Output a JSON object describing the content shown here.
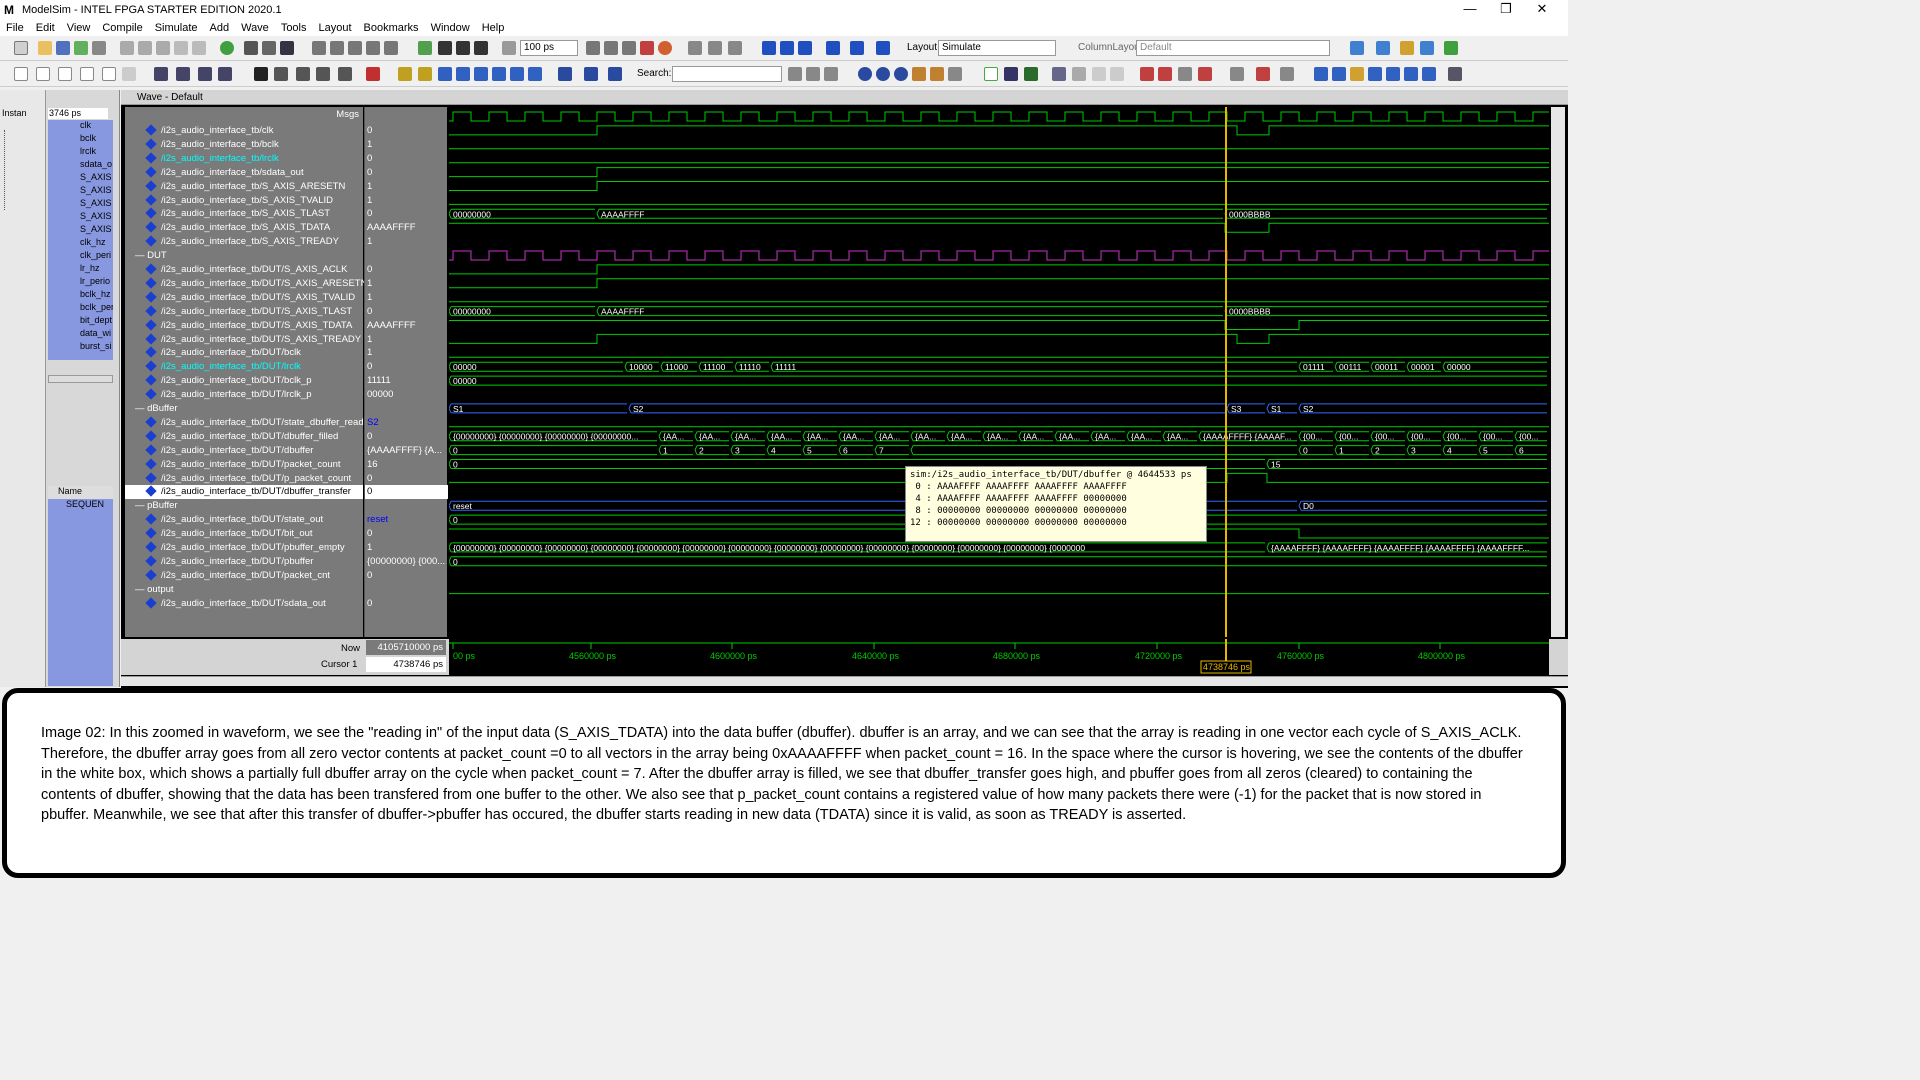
{
  "window": {
    "app_icon": "M",
    "title": "ModelSim - INTEL FPGA STARTER EDITION 2020.1",
    "controls": [
      "—",
      "❐",
      "✕"
    ]
  },
  "menu": [
    "File",
    "Edit",
    "View",
    "Compile",
    "Simulate",
    "Add",
    "Wave",
    "Tools",
    "Layout",
    "Bookmarks",
    "Window",
    "Help"
  ],
  "toolbar": {
    "run_length": "100 ps",
    "layout_label": "Layout",
    "layout_value": "Simulate",
    "column_layout_label": "ColumnLayout",
    "column_layout_value": "Default",
    "search_label": "Search:",
    "search_value": ""
  },
  "left_panel": {
    "tab_label": "Instan",
    "time_value": "3746 ps"
  },
  "objects_panel": {
    "items": [
      "clk",
      "bclk",
      "lrclk",
      "sdata_o",
      "S_AXIS",
      "S_AXIS",
      "S_AXIS",
      "S_AXIS",
      "S_AXIS",
      "clk_hz",
      "clk_peri",
      "lr_hz",
      "lr_perio",
      "bclk_hz",
      "bclk_per",
      "bit_dept",
      "data_wi",
      "burst_si"
    ]
  },
  "process_panel": {
    "header": "Name",
    "item": "SEQUEN"
  },
  "wave_window": {
    "title": "Wave - Default",
    "msgs_header": "Msgs",
    "rows": [
      {
        "kind": "sig",
        "name": "/i2s_audio_interface_tb/clk",
        "value": "0"
      },
      {
        "kind": "sig",
        "name": "/i2s_audio_interface_tb/bclk",
        "value": "1"
      },
      {
        "kind": "sig",
        "name": "/i2s_audio_interface_tb/lrclk",
        "value": "0",
        "hl": true
      },
      {
        "kind": "sig",
        "name": "/i2s_audio_interface_tb/sdata_out",
        "value": "0"
      },
      {
        "kind": "sig",
        "name": "/i2s_audio_interface_tb/S_AXIS_ARESETN",
        "value": "1"
      },
      {
        "kind": "sig",
        "name": "/i2s_audio_interface_tb/S_AXIS_TVALID",
        "value": "1"
      },
      {
        "kind": "sig",
        "name": "/i2s_audio_interface_tb/S_AXIS_TLAST",
        "value": "0"
      },
      {
        "kind": "sig",
        "name": "/i2s_audio_interface_tb/S_AXIS_TDATA",
        "value": "AAAAFFFF",
        "expand": true
      },
      {
        "kind": "sig",
        "name": "/i2s_audio_interface_tb/S_AXIS_TREADY",
        "value": "1"
      },
      {
        "kind": "group",
        "name": "DUT"
      },
      {
        "kind": "sig",
        "name": "/i2s_audio_interface_tb/DUT/S_AXIS_ACLK",
        "value": "0"
      },
      {
        "kind": "sig",
        "name": "/i2s_audio_interface_tb/DUT/S_AXIS_ARESETN",
        "value": "1"
      },
      {
        "kind": "sig",
        "name": "/i2s_audio_interface_tb/DUT/S_AXIS_TVALID",
        "value": "1"
      },
      {
        "kind": "sig",
        "name": "/i2s_audio_interface_tb/DUT/S_AXIS_TLAST",
        "value": "0"
      },
      {
        "kind": "sig",
        "name": "/i2s_audio_interface_tb/DUT/S_AXIS_TDATA",
        "value": "AAAAFFFF",
        "expand": true
      },
      {
        "kind": "sig",
        "name": "/i2s_audio_interface_tb/DUT/S_AXIS_TREADY",
        "value": "1"
      },
      {
        "kind": "sig",
        "name": "/i2s_audio_interface_tb/DUT/bclk",
        "value": "1"
      },
      {
        "kind": "sig",
        "name": "/i2s_audio_interface_tb/DUT/lrclk",
        "value": "0",
        "hl": true
      },
      {
        "kind": "sig",
        "name": "/i2s_audio_interface_tb/DUT/bclk_p",
        "value": "11111",
        "expand": true
      },
      {
        "kind": "sig",
        "name": "/i2s_audio_interface_tb/DUT/lrclk_p",
        "value": "00000",
        "expand": true
      },
      {
        "kind": "group",
        "name": "dBuffer"
      },
      {
        "kind": "sig",
        "name": "/i2s_audio_interface_tb/DUT/state_dbuffer_read",
        "value": "S2",
        "blue": true
      },
      {
        "kind": "sig",
        "name": "/i2s_audio_interface_tb/DUT/dbuffer_filled",
        "value": "0"
      },
      {
        "kind": "sig",
        "name": "/i2s_audio_interface_tb/DUT/dbuffer",
        "value": "{AAAAFFFF} {A...",
        "expand": true
      },
      {
        "kind": "sig",
        "name": "/i2s_audio_interface_tb/DUT/packet_count",
        "value": "16"
      },
      {
        "kind": "sig",
        "name": "/i2s_audio_interface_tb/DUT/p_packet_count",
        "value": "0"
      },
      {
        "kind": "sig",
        "name": "/i2s_audio_interface_tb/DUT/dbuffer_transfer",
        "value": "0",
        "sel": true
      },
      {
        "kind": "group",
        "name": "pBuffer"
      },
      {
        "kind": "sig",
        "name": "/i2s_audio_interface_tb/DUT/state_out",
        "value": "reset",
        "blue": true
      },
      {
        "kind": "sig",
        "name": "/i2s_audio_interface_tb/DUT/bit_out",
        "value": "0"
      },
      {
        "kind": "sig",
        "name": "/i2s_audio_interface_tb/DUT/pbuffer_empty",
        "value": "1"
      },
      {
        "kind": "sig",
        "name": "/i2s_audio_interface_tb/DUT/pbuffer",
        "value": "{00000000} {000...",
        "expand": true
      },
      {
        "kind": "sig",
        "name": "/i2s_audio_interface_tb/DUT/packet_cnt",
        "value": "0"
      },
      {
        "kind": "group",
        "name": "output"
      },
      {
        "kind": "sig",
        "name": "/i2s_audio_interface_tb/DUT/sdata_out",
        "value": "0"
      }
    ],
    "now_label": "Now",
    "now_value": "4105710000 ps",
    "cursor_label": "Cursor 1",
    "cursor_value": "4738746 ps",
    "cursor_flag": "4738746 ps",
    "time_ticks": [
      "00 ps",
      "4560000 ps",
      "4600000 ps",
      "4640000 ps",
      "4680000 ps",
      "4720000 ps",
      "4760000 ps",
      "4800000 ps"
    ],
    "bus_labels": {
      "tdata_a": "00000000",
      "tdata_b": "AAAAFFFF",
      "tdata_c": "0000BBBB",
      "bclk_p": [
        "00000",
        "10000",
        "11000",
        "11100",
        "11110",
        "11111",
        "01111",
        "00111",
        "00011",
        "00001",
        "00000"
      ],
      "lrclk_p": "00000",
      "state_read": [
        "S1",
        "S2",
        "S3",
        "S1",
        "S2"
      ],
      "dbuffer_left": "{00000000} {00000000} {00000000} {00000000...",
      "dbuffer_mid": "{AA...",
      "dbuffer_right": "{00...",
      "dbuffer_cursor": "{AAAAFFFF} {AAAAF...",
      "packet_count": [
        "0",
        "1",
        "2",
        "3",
        "4",
        "5",
        "6",
        "7",
        "0",
        "1",
        "2",
        "3",
        "4",
        "5",
        "6"
      ],
      "p_packet_count": [
        "0",
        "15"
      ],
      "state_out": [
        "reset",
        "D0"
      ],
      "bit_out": "0",
      "pbuffer_left": "{00000000} {00000000} {00000000} {00000000} {00000000} {00000000} {00000000} {00000000} {00000000} {00000000} {00000000} {00000000} {00000000} {0000000",
      "pbuffer_right": "{AAAAFFFF} {AAAAFFFF} {AAAAFFFF} {AAAAFFFF} {AAAAFFFF...",
      "packet_cnt": "0"
    },
    "tooltip": "sim:/i2s_audio_interface_tb/DUT/dbuffer @ 4644533 ps\n 0 : AAAAFFFF AAAAFFFF AAAAFFFF AAAAFFFF\n 4 : AAAAFFFF AAAAFFFF AAAAFFFF 00000000\n 8 : 00000000 00000000 00000000 00000000\n12 : 00000000 00000000 00000000 00000000"
  },
  "colors": {
    "wave_green": "#00cc00",
    "wave_magenta": "#cc33cc",
    "wave_blue": "#3366ff",
    "cursor_yellow": "#e8b800"
  },
  "caption": "Image 02: In this zoomed in waveform, we see the \"reading in\" of the input data (S_AXIS_TDATA) into the data buffer (dbuffer). dbuffer is an array, and we can see that the array is reading in one vector each cycle of S_AXIS_ACLK. Therefore, the dbuffer array goes from all zero vector contents at packet_count =0 to all vectors in the array being 0xAAAAFFFF when packet_count = 16. In the space where the cursor is hovering, we see the contents of the dbuffer in the white box, which shows a partially full dbuffer array on the cycle when packet_count = 7. After the dbuffer array is filled, we see that dbuffer_transfer goes high, and pbuffer goes from all zeros (cleared) to containing the contents of dbuffer, showing that the data has been transfered from one buffer to the other. We also see that p_packet_count contains a registered value of how many packets there were (-1) for the packet that is now stored in pbuffer. Meanwhile, we see that after this transfer of dbuffer->pbuffer has occured, the dbuffer starts reading in new data (TDATA) since it is valid, as soon as TREADY is asserted."
}
